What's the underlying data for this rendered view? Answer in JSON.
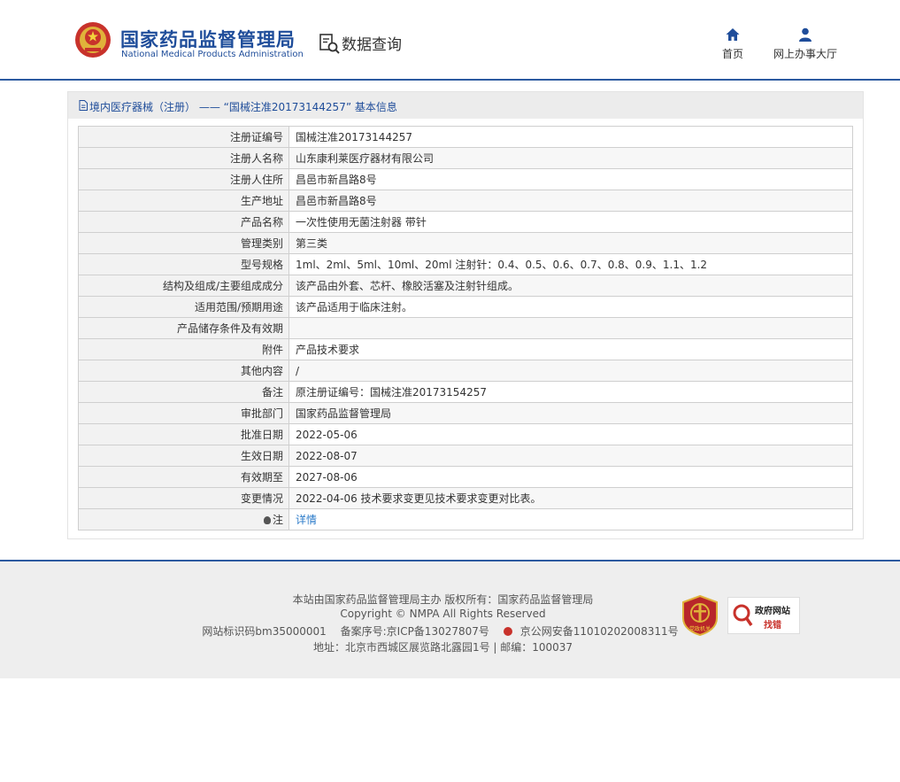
{
  "header": {
    "org_name_cn": "国家药品监督管理局",
    "org_name_en": "National Medical Products Administration",
    "db_title": "数据查询",
    "nav": [
      {
        "label": "首页",
        "icon": "home-icon"
      },
      {
        "label": "网上办事大厅",
        "icon": "user-icon"
      }
    ]
  },
  "breadcrumb": {
    "text": "境内医疗器械（注册） —— “国械注准20173144257” 基本信息"
  },
  "rows": [
    {
      "key": "注册证编号",
      "value": "国械注准20173144257"
    },
    {
      "key": "注册人名称",
      "value": "山东康利莱医疗器材有限公司"
    },
    {
      "key": "注册人住所",
      "value": "昌邑市新昌路8号"
    },
    {
      "key": "生产地址",
      "value": "昌邑市新昌路8号"
    },
    {
      "key": "产品名称",
      "value": "一次性使用无菌注射器 带针"
    },
    {
      "key": "管理类别",
      "value": "第三类"
    },
    {
      "key": "型号规格",
      "value": "1ml、2ml、5ml、10ml、20ml 注射针：0.4、0.5、0.6、0.7、0.8、0.9、1.1、1.2"
    },
    {
      "key": "结构及组成/主要组成成分",
      "value": "该产品由外套、芯杆、橡胶活塞及注射针组成。"
    },
    {
      "key": "适用范围/预期用途",
      "value": "该产品适用于临床注射。"
    },
    {
      "key": "产品储存条件及有效期",
      "value": ""
    },
    {
      "key": "附件",
      "value": "产品技术要求"
    },
    {
      "key": "其他内容",
      "value": "/"
    },
    {
      "key": "备注",
      "value": "原注册证编号：国械注准20173154257"
    },
    {
      "key": "审批部门",
      "value": "国家药品监督管理局"
    },
    {
      "key": "批准日期",
      "value": "2022-05-06"
    },
    {
      "key": "生效日期",
      "value": "2022-08-07"
    },
    {
      "key": "有效期至",
      "value": "2027-08-06"
    },
    {
      "key": "变更情况",
      "value": "2022-04-06 技术要求变更见技术要求变更对比表。"
    }
  ],
  "note_row": {
    "key": "注",
    "link_label": "详情"
  },
  "footer": {
    "line1": "本站由国家药品监督管理局主办 版权所有：国家药品监督管理局",
    "line2": "Copyright © NMPA All Rights Reserved",
    "site_id": "网站标识码bm35000001",
    "icp": "备案序号:京ICP备13027807号",
    "police": "京公网安备11010202008311号",
    "address": "地址：北京市西城区展览路北露园1号 | 邮编：100037",
    "badge_party_text": "党政机关",
    "gov_badge_line1": "政府网站",
    "gov_badge_line2": "找错"
  },
  "colors": {
    "brand_blue": "#1f4d9a",
    "rule_blue": "#2c5aa0",
    "link": "#2b7bc9",
    "badge_red": "#c8322b"
  }
}
